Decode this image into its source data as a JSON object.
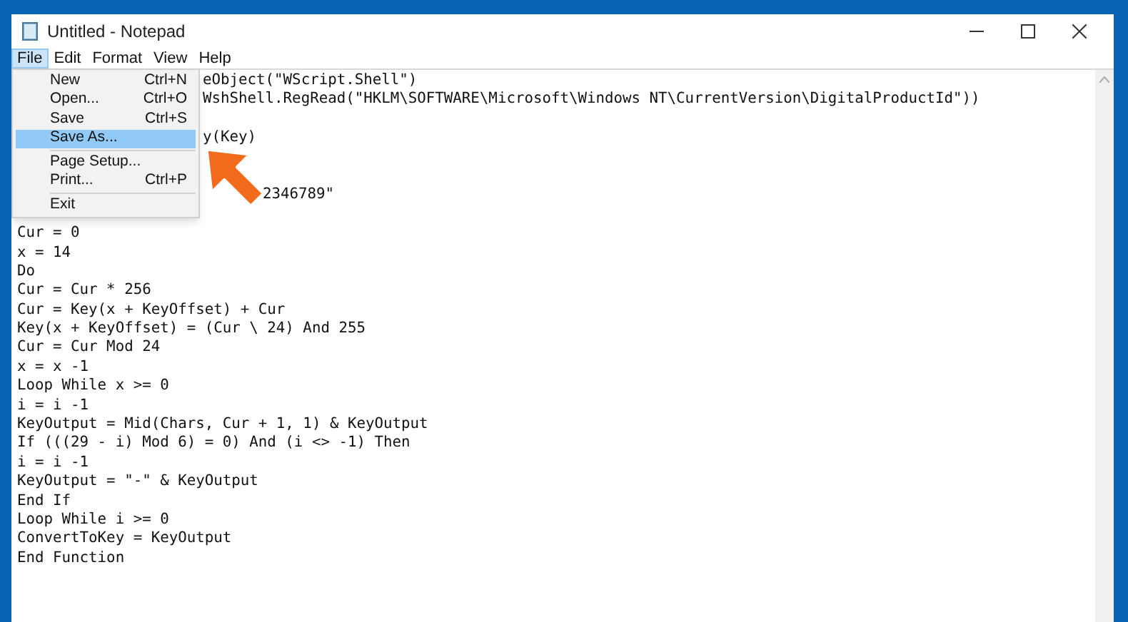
{
  "window": {
    "title": "Untitled - Notepad"
  },
  "menu_bar": [
    {
      "label": "File",
      "selected": true
    },
    {
      "label": "Edit",
      "selected": false
    },
    {
      "label": "Format",
      "selected": false
    },
    {
      "label": "View",
      "selected": false
    },
    {
      "label": "Help",
      "selected": false
    }
  ],
  "file_menu": [
    {
      "kind": "item",
      "label": "New",
      "shortcut": "Ctrl+N",
      "selected": false
    },
    {
      "kind": "item",
      "label": "Open...",
      "shortcut": "Ctrl+O",
      "selected": false
    },
    {
      "kind": "item",
      "label": "Save",
      "shortcut": "Ctrl+S",
      "selected": false
    },
    {
      "kind": "item",
      "label": "Save As...",
      "selected": true
    },
    {
      "kind": "separator"
    },
    {
      "kind": "item",
      "label": "Page Setup...",
      "selected": false
    },
    {
      "kind": "item",
      "label": "Print...",
      "shortcut": "Ctrl+P",
      "selected": false
    },
    {
      "kind": "separator"
    },
    {
      "kind": "item",
      "label": "Exit",
      "selected": false
    }
  ],
  "editor": {
    "lines": [
      {
        "kind": "partly_hidden",
        "text": "eObject(\"WScript.Shell\")"
      },
      {
        "kind": "partly_hidden",
        "text": "WshShell.RegRead(\"HKLM\\SOFTWARE\\Microsoft\\Windows NT\\CurrentVersion\\DigitalProductId\"))"
      },
      {
        "kind": "blank"
      },
      {
        "kind": "partly_hidden",
        "text": "y(Key)"
      },
      {
        "kind": "blank"
      },
      {
        "kind": "blank"
      },
      {
        "kind": "behind_arrow",
        "text": "2346789\""
      },
      {
        "kind": "blank"
      },
      {
        "kind": "text",
        "text": "Cur = 0"
      },
      {
        "kind": "text",
        "text": "x = 14"
      },
      {
        "kind": "text",
        "text": "Do"
      },
      {
        "kind": "text",
        "text": "Cur = Cur * 256"
      },
      {
        "kind": "text",
        "text": "Cur = Key(x + KeyOffset) + Cur"
      },
      {
        "kind": "text",
        "text": "Key(x + KeyOffset) = (Cur \\ 24) And 255"
      },
      {
        "kind": "text",
        "text": "Cur = Cur Mod 24"
      },
      {
        "kind": "text",
        "text": "x = x -1"
      },
      {
        "kind": "text",
        "text": "Loop While x >= 0"
      },
      {
        "kind": "text",
        "text": "i = i -1"
      },
      {
        "kind": "text",
        "text": "KeyOutput = Mid(Chars, Cur + 1, 1) & KeyOutput"
      },
      {
        "kind": "text",
        "text": "If (((29 - i) Mod 6) = 0) And (i <> -1) Then"
      },
      {
        "kind": "text",
        "text": "i = i -1"
      },
      {
        "kind": "text",
        "text": "KeyOutput = \"-\" & KeyOutput"
      },
      {
        "kind": "text",
        "text": "End If"
      },
      {
        "kind": "text",
        "text": "Loop While i >= 0"
      },
      {
        "kind": "text",
        "text": "ConvertToKey = KeyOutput"
      },
      {
        "kind": "text",
        "text": "End Function"
      }
    ]
  }
}
